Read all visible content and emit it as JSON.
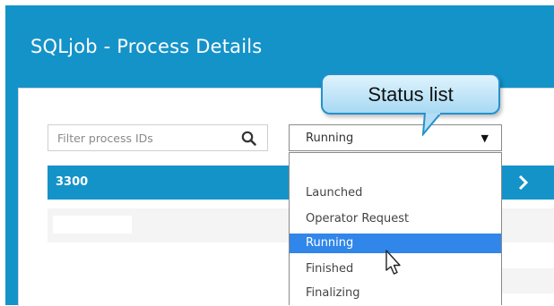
{
  "window": {
    "title": "SQLjob - Process Details"
  },
  "filter": {
    "placeholder": "Filter process IDs",
    "icon": "search-icon"
  },
  "status_select": {
    "value": "Running"
  },
  "rows": [
    {
      "id": "3300",
      "selected": true
    }
  ],
  "dropdown": {
    "options": [
      "Launched",
      "Operator Request",
      "Running",
      "Finished",
      "Finalizing"
    ],
    "highlighted": "Running"
  },
  "callout": {
    "text": "Status list"
  },
  "colors": {
    "header": "#1493c9",
    "selected_row": "#1493c9",
    "highlight": "#3186ea"
  }
}
